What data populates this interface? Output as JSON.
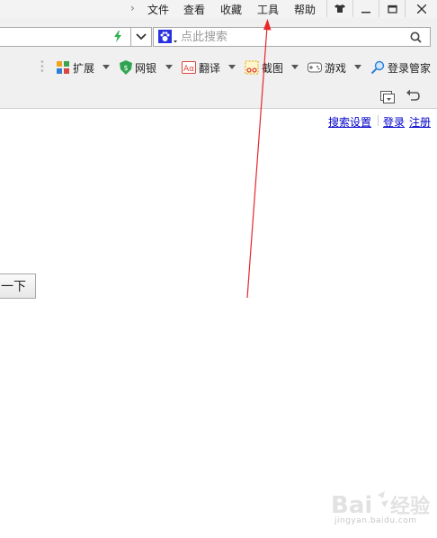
{
  "menubar": {
    "items": [
      "文件",
      "查看",
      "收藏",
      "工具",
      "帮助"
    ]
  },
  "search": {
    "placeholder": "点此搜索"
  },
  "toolbar": {
    "items": [
      {
        "label": "扩展"
      },
      {
        "label": "网银"
      },
      {
        "label": "翻译"
      },
      {
        "label": "截图"
      },
      {
        "label": "游戏"
      },
      {
        "label": "登录管家"
      }
    ]
  },
  "page": {
    "links": [
      "搜索设置",
      "登录",
      "注册"
    ],
    "button_label": "一下"
  },
  "watermark": {
    "line2": "jingyan.baidu.com"
  },
  "colors": {
    "link": "#0000cc",
    "annotation_arrow": "#e8262a"
  }
}
